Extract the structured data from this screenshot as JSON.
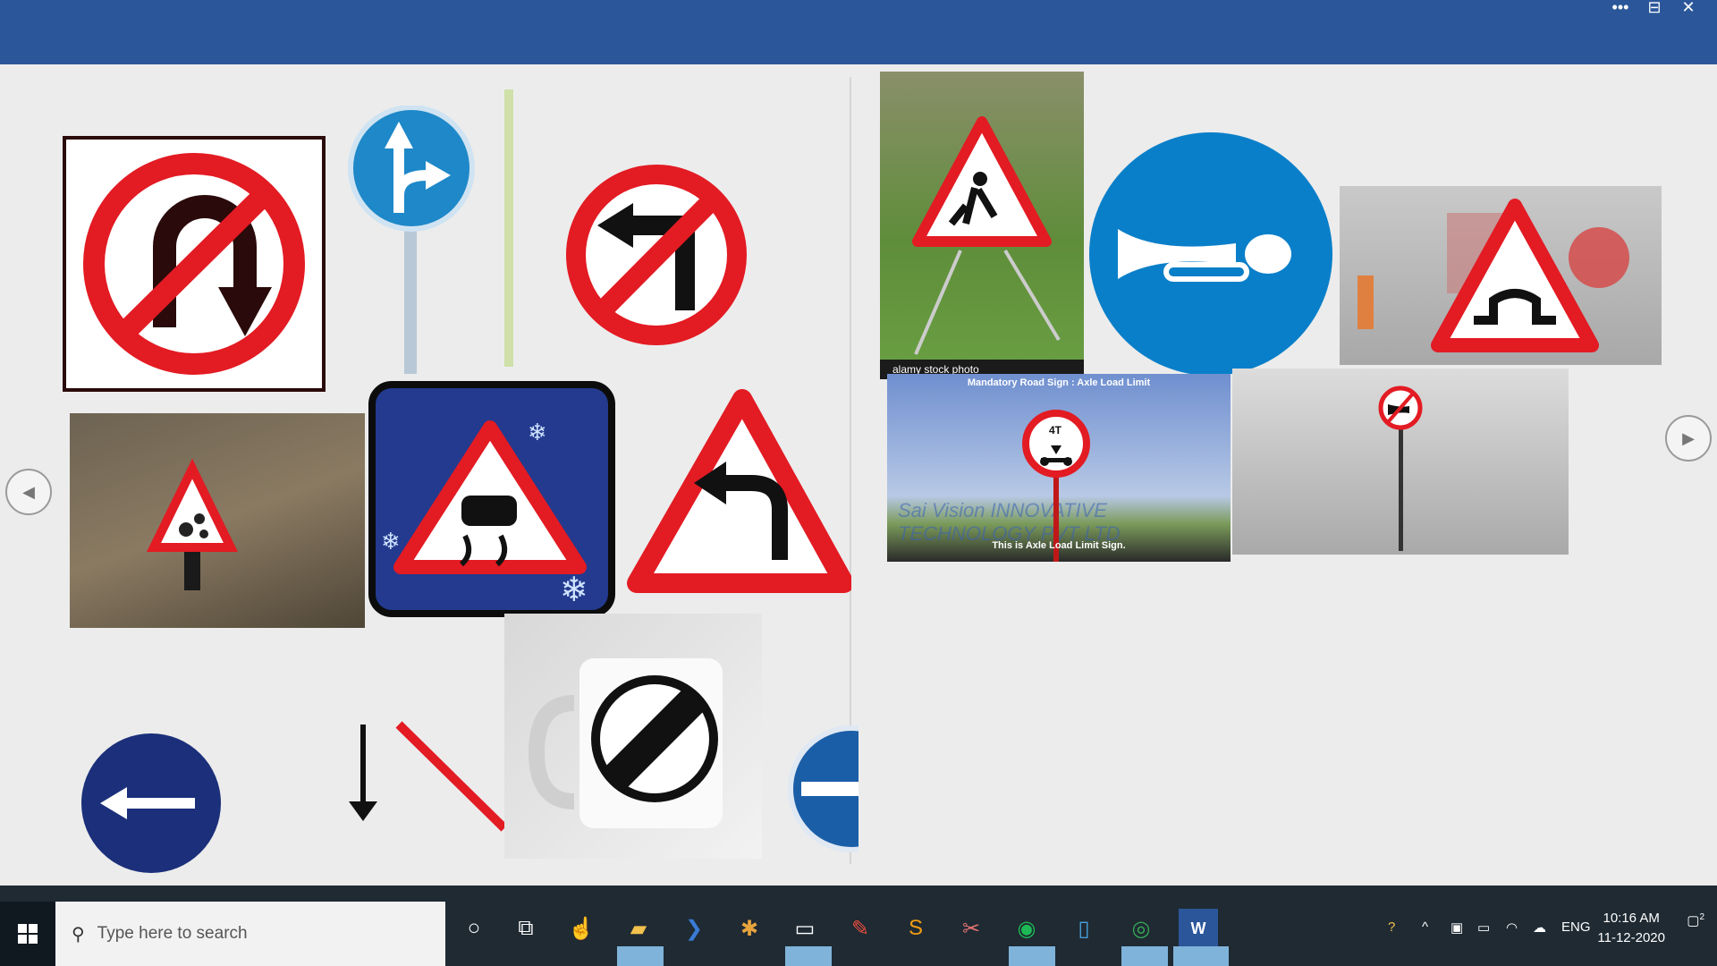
{
  "window": {
    "more_label": "•••",
    "minimize_label": "⊟",
    "close_label": "✕"
  },
  "gallery_left": {
    "items": [
      {
        "name": "no-u-turn-sign"
      },
      {
        "name": "go-straight-or-right-sign"
      },
      {
        "name": "no-left-turn-sign"
      },
      {
        "name": "falling-rocks-sign-photo"
      },
      {
        "name": "slippery-road-snow-sign"
      },
      {
        "name": "left-curve-warning-sign"
      },
      {
        "name": "keep-left-sign"
      },
      {
        "name": "arrow-and-stroke-graphic"
      },
      {
        "name": "end-of-restrictions-mug"
      },
      {
        "name": "no-entry-sign-partial"
      }
    ]
  },
  "gallery_right": {
    "stock_caption": "alamy stock photo",
    "axle_title": "Mandatory Road Sign : Axle Load Limit",
    "axle_weight": "4T",
    "axle_caption": "This is Axle Load Limit Sign.",
    "axle_watermark": "Sai Vision INNOVATIVE TECHNOLOGY PVT LTD"
  },
  "nav": {
    "prev": "◀",
    "next": "▶"
  },
  "colors": {
    "red": "#e31b23",
    "blue": "#0a7fc9",
    "navy": "#1b2f7a",
    "word_blue": "#2b579a"
  },
  "taskbar": {
    "search_placeholder": "Type here to search",
    "tray_language": "ENG",
    "time": "10:16 AM",
    "date": "11-12-2020",
    "notification_count": "2"
  }
}
